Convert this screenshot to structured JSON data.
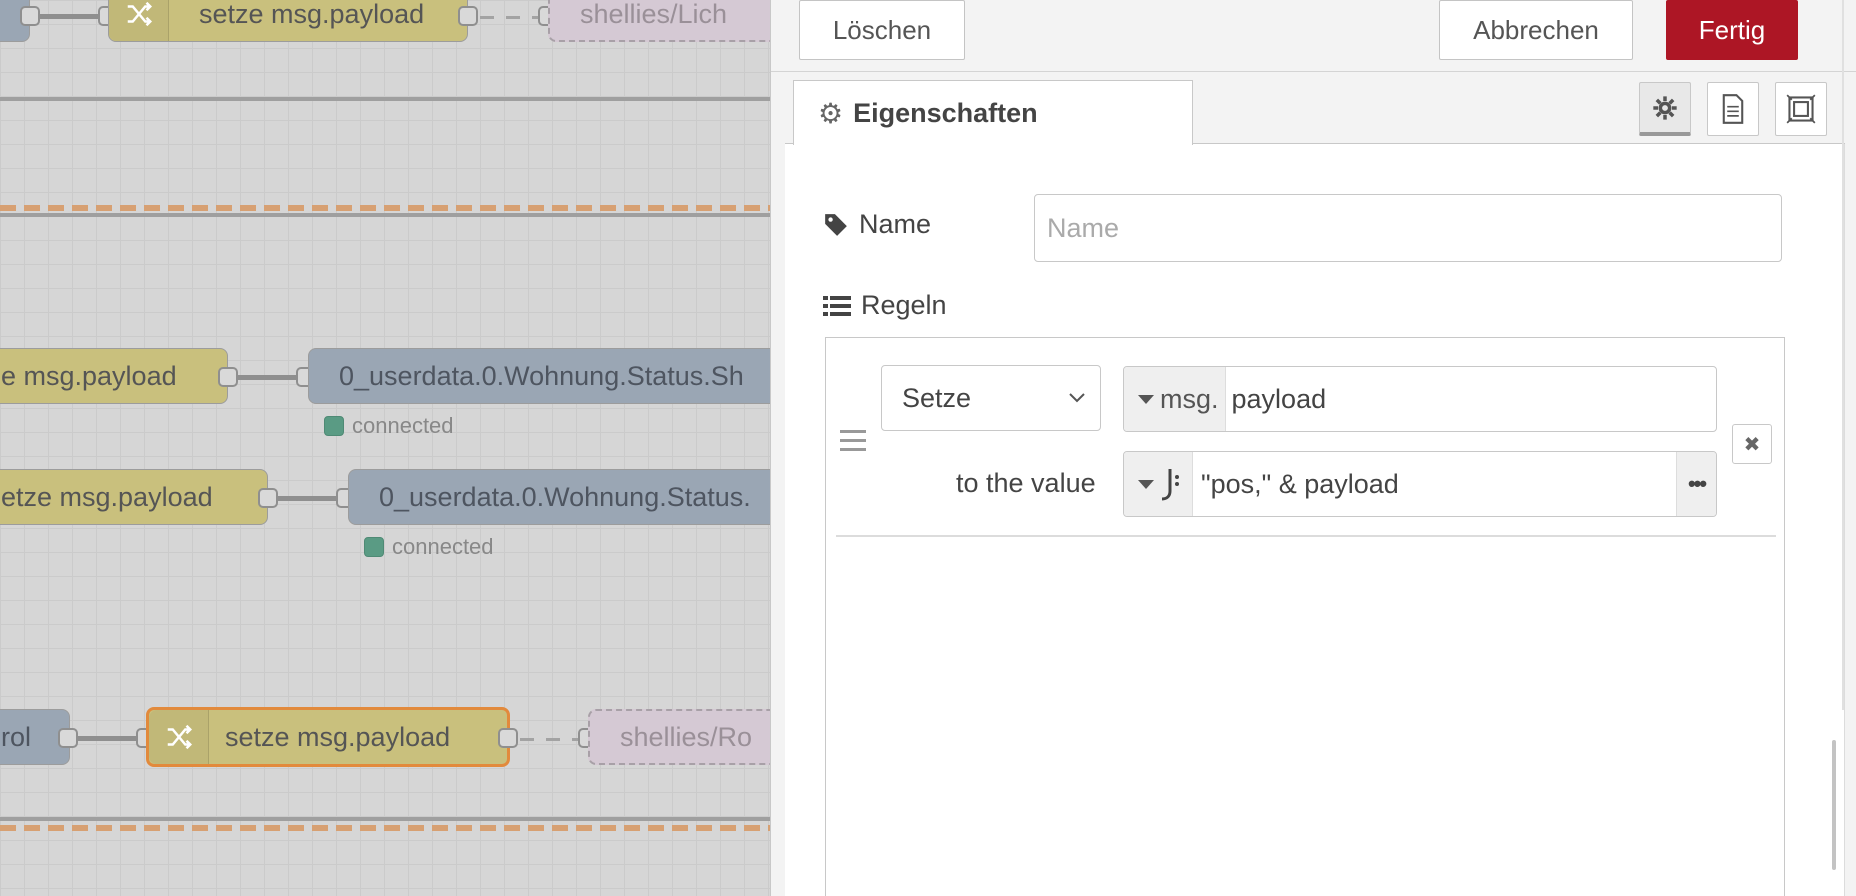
{
  "canvas": {
    "nodes": [
      {
        "id": "top-change",
        "type": "change",
        "label": "setze msg.payload"
      },
      {
        "id": "top-mqtt",
        "type": "mqtt",
        "label": "shellies/Lich"
      },
      {
        "id": "mid1-change",
        "type": "change",
        "label": "e msg.payload"
      },
      {
        "id": "mid1-iob",
        "type": "iobroker",
        "label": "0_userdata.0.Wohnung.Status.Sh",
        "status": "connected"
      },
      {
        "id": "mid2-change",
        "type": "change",
        "label": "etze msg.payload"
      },
      {
        "id": "mid2-iob",
        "type": "iobroker",
        "label": "0_userdata.0.Wohnung.Status.",
        "status": "connected"
      },
      {
        "id": "bot-left",
        "type": "iobroker",
        "label": "rol"
      },
      {
        "id": "bot-change",
        "type": "change",
        "label": "setze msg.payload",
        "selected": true
      },
      {
        "id": "bot-mqtt",
        "type": "mqtt",
        "label": "shellies/Ro"
      }
    ]
  },
  "toolbar": {
    "delete_label": "Löschen",
    "cancel_label": "Abbrechen",
    "done_label": "Fertig",
    "done_color": "#ad1625"
  },
  "tabs": {
    "properties_label": "Eigenschaften",
    "icons": [
      "gear-icon",
      "document-icon",
      "appearance-icon"
    ]
  },
  "form": {
    "name_label": "Name",
    "name_value": "",
    "name_placeholder": "Name",
    "rules_label": "Regeln",
    "rule": {
      "action": "Setze",
      "target_prefix": "msg.",
      "target_value": "payload",
      "value_label": "to the value",
      "value_expression": "\"pos,\" & payload"
    }
  }
}
